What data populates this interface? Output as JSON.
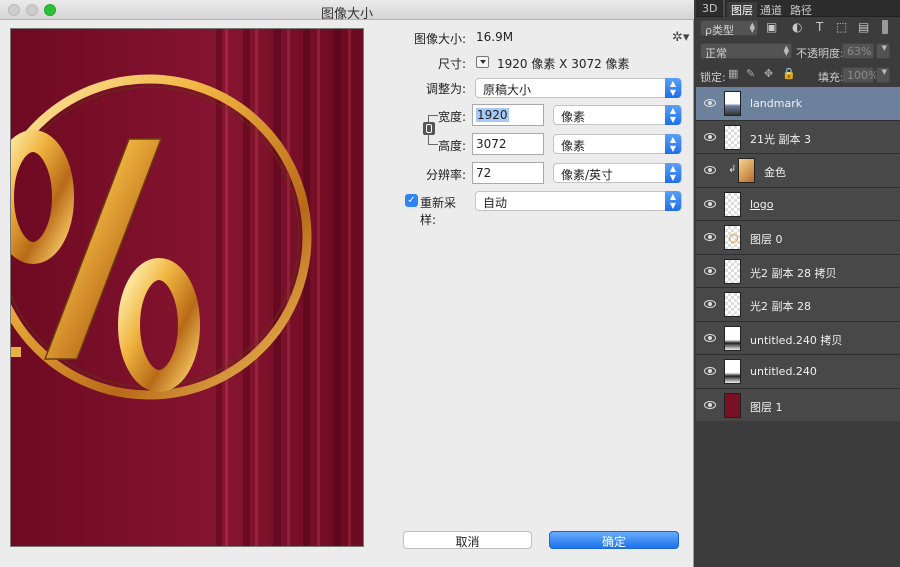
{
  "dialog": {
    "title": "图像大小",
    "image_size_label": "图像大小:",
    "image_size_value": "16.9M",
    "dimensions_label": "尺寸:",
    "dimensions_value": "1920 像素  X  3072 像素",
    "fit_to_label": "调整为:",
    "fit_to_value": "原稿大小",
    "width_label": "宽度:",
    "width_value": "1920",
    "width_unit": "像素",
    "height_label": "高度:",
    "height_value": "3072",
    "height_unit": "像素",
    "resolution_label": "分辨率:",
    "resolution_value": "72",
    "resolution_unit": "像素/英寸",
    "resample_label": "重新采样:",
    "resample_checked": true,
    "resample_value": "自动",
    "cancel_label": "取消",
    "ok_label": "确定",
    "gear_icon": "gear-icon",
    "preview_colors": {
      "background": "#7a0d26",
      "gold": "#e8a93a"
    }
  },
  "panel": {
    "tabs": [
      "3D",
      "图层",
      "通道",
      "路径"
    ],
    "active_tab": "图层",
    "filter_label": "ρ类型",
    "blend_mode": "正常",
    "opacity_label": "不透明度:",
    "opacity_value": "63%",
    "lock_label": "锁定:",
    "fill_label": "填充:",
    "fill_value": "100%",
    "layers": [
      {
        "name": "landmark",
        "selected": true,
        "thumb": "lm"
      },
      {
        "name": "21光 副本 3",
        "selected": false,
        "thumb": "trans"
      },
      {
        "name": "金色",
        "selected": false,
        "thumb": "gold",
        "clipped": true
      },
      {
        "name": "logo",
        "selected": false,
        "thumb": "trans",
        "underlined": true
      },
      {
        "name": "图层 0",
        "selected": false,
        "thumb": "dot"
      },
      {
        "name": "光2 副本 28 拷贝",
        "selected": false,
        "thumb": "trans"
      },
      {
        "name": "光2 副本 28",
        "selected": false,
        "thumb": "trans"
      },
      {
        "name": "untitled.240 拷贝",
        "selected": false,
        "thumb": "dark"
      },
      {
        "name": "untitled.240",
        "selected": false,
        "thumb": "dark"
      },
      {
        "name": "图层 1",
        "selected": false,
        "thumb": "red"
      }
    ]
  }
}
